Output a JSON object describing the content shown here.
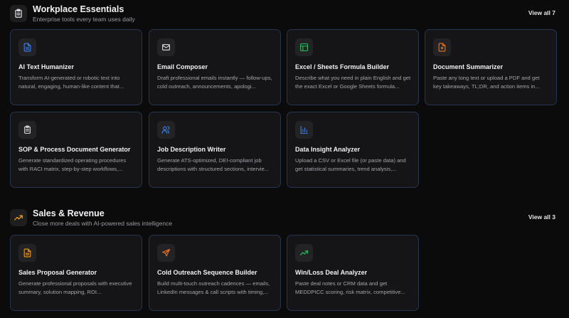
{
  "sections": [
    {
      "title": "Workplace Essentials",
      "subtitle": "Enterprise tools every team uses daily",
      "view_all": "View all 7",
      "icon": "clipboard-icon",
      "cards": [
        {
          "title": "AI Text Humanizer",
          "desc": "Transform AI-generated or robotic text into natural, engaging, human-like content that...",
          "icon": "document-icon",
          "color": "#3b82f6"
        },
        {
          "title": "Email Composer",
          "desc": "Draft professional emails instantly — follow-ups, cold outreach, announcements, apologi...",
          "icon": "mail-icon",
          "color": "#e5e5e5"
        },
        {
          "title": "Excel / Sheets Formula Builder",
          "desc": "Describe what you need in plain English and get the exact Excel or Google Sheets formula...",
          "icon": "table-icon",
          "color": "#22c55e"
        },
        {
          "title": "Document Summarizer",
          "desc": "Paste any long text or upload a PDF and get key takeaways, TL;DR, and action items in...",
          "icon": "file-text-icon",
          "color": "#f97316"
        },
        {
          "title": "SOP & Process Document Generator",
          "desc": "Generate standardized operating procedures with RACI matrix, step-by-step workflows,...",
          "icon": "clipboard-list-icon",
          "color": "#e5e5e5"
        },
        {
          "title": "Job Description Writer",
          "desc": "Generate ATS-optimized, DEI-compliant job descriptions with structured sections, intervie...",
          "icon": "users-icon",
          "color": "#3b82f6"
        },
        {
          "title": "Data Insight Analyzer",
          "desc": "Upload a CSV or Excel file (or paste data) and get statistical summaries, trend analysis,...",
          "icon": "bar-chart-icon",
          "color": "#3b82f6"
        }
      ]
    },
    {
      "title": "Sales & Revenue",
      "subtitle": "Close more deals with AI-powered sales intelligence",
      "view_all": "View all 3",
      "icon": "trending-up-icon",
      "cards": [
        {
          "title": "Sales Proposal Generator",
          "desc": "Generate professional proposals with executive summary, solution mapping, ROI...",
          "icon": "file-lines-icon",
          "color": "#f59e0b"
        },
        {
          "title": "Cold Outreach Sequence Builder",
          "desc": "Build multi-touch outreach cadences — emails, LinkedIn messages & call scripts with timing,...",
          "icon": "send-icon",
          "color": "#f97316"
        },
        {
          "title": "Win/Loss Deal Analyzer",
          "desc": "Paste deal notes or CRM data and get MEDDPICC scoring, risk matrix, competitive...",
          "icon": "trending-up-icon",
          "color": "#22c55e"
        }
      ]
    }
  ]
}
